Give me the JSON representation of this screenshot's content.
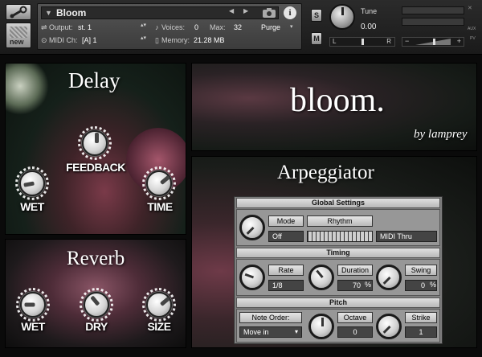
{
  "header": {
    "instrument_name": "Bloom",
    "new_label": "new",
    "output_label": "Output:",
    "output_value": "st. 1",
    "midi_label": "MIDI Ch:",
    "midi_value": "[A]  1",
    "voices_label": "Voices:",
    "voices_value": "0",
    "max_label": "Max:",
    "max_value": "32",
    "memory_label": "Memory:",
    "memory_value": "21.28 MB",
    "purge_label": "Purge",
    "s_label": "S",
    "m_label": "M",
    "tune_label": "Tune",
    "tune_value": "0.00",
    "pan_left": "L",
    "pan_right": "R",
    "vol_minus": "−",
    "vol_plus": "+",
    "aux_label": "AUX",
    "pv_label": "PV"
  },
  "delay": {
    "title": "Delay",
    "feedback_label": "FEEDBACK",
    "wet_label": "WET",
    "time_label": "TIME"
  },
  "bloom": {
    "title": "bloom.",
    "byline": "by lamprey"
  },
  "reverb": {
    "title": "Reverb",
    "wet_label": "WET",
    "dry_label": "DRY",
    "size_label": "SIZE"
  },
  "arp": {
    "title": "Arpeggiator",
    "global_header": "Global Settings",
    "mode_label": "Mode",
    "mode_value": "Off",
    "rhythm_label": "Rhythm",
    "midi_thru_label": "MIDI Thru",
    "timing_header": "Timing",
    "rate_label": "Rate",
    "rate_value": "1/8",
    "duration_label": "Duration",
    "duration_value": "70",
    "duration_unit": "%",
    "swing_label": "Swing",
    "swing_value": "0",
    "swing_unit": "%",
    "pitch_header": "Pitch",
    "note_order_label": "Note Order:",
    "note_order_value": "Move in",
    "octave_label": "Octave",
    "octave_value": "0",
    "strike_label": "Strike",
    "strike_value": "1"
  }
}
